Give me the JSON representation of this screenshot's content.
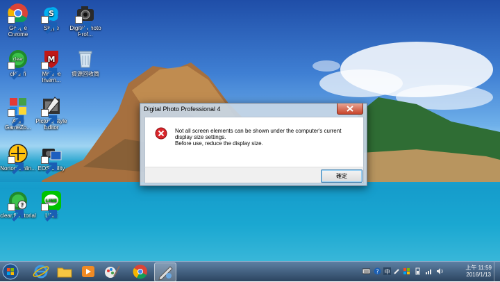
{
  "desktop_icons": [
    {
      "label": "Google Chrome",
      "icon": "chrome-icon"
    },
    {
      "label": "Skype",
      "icon": "skype-icon"
    },
    {
      "label": "Digital Photo Prof...",
      "icon": "camera-icon"
    },
    {
      "label": "clear.fi",
      "icon": "clearfi-icon"
    },
    {
      "label": "McAfee Intern...",
      "icon": "mcafee-icon"
    },
    {
      "label": "資源回收筒",
      "icon": "recycle-bin-icon"
    },
    {
      "label": "Acer GameZo...",
      "icon": "gamezone-icon"
    },
    {
      "label": "Picture Style Editor",
      "icon": "picture-style-icon"
    },
    {
      "label": "Norton Onlin...",
      "icon": "norton-icon"
    },
    {
      "label": "EOS Utility",
      "icon": "eos-utility-icon"
    },
    {
      "label": "clear.fi Tutorial",
      "icon": "clearfi-tutorial-icon"
    },
    {
      "label": "LINE",
      "icon": "line-icon"
    }
  ],
  "dialog": {
    "title": "Digital Photo Professional 4",
    "message_line1": "Not all screen elements can be shown under the computer's current",
    "message_line2": "display size settings.",
    "message_line3": "Before use, reduce the display size.",
    "ok_label": "確定",
    "icon": "error-icon"
  },
  "taskbar": {
    "pinned": [
      "start-orb-icon",
      "internet-explorer-icon",
      "file-explorer-icon",
      "media-player-icon",
      "paint-icon",
      "chrome-icon",
      "photo-app-icon"
    ],
    "clock_time": "上午 11:59",
    "clock_date": "2016/1/13"
  },
  "colors": {
    "taskbar": "#2c4560",
    "close_button": "#c7442a",
    "error_red": "#d9262b"
  }
}
